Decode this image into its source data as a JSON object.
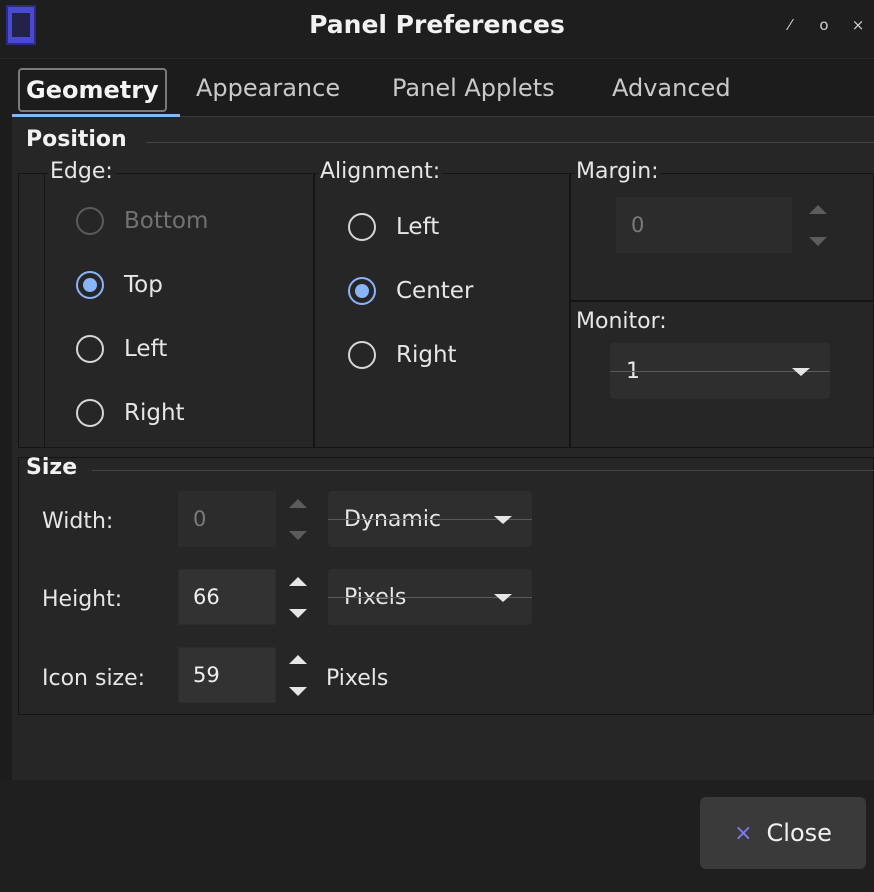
{
  "window": {
    "title": "Panel Preferences",
    "controls": [
      "⁄",
      "o",
      "×"
    ]
  },
  "tabs": [
    {
      "label": "Geometry",
      "active": true
    },
    {
      "label": "Appearance",
      "active": false
    },
    {
      "label": "Panel Applets",
      "active": false
    },
    {
      "label": "Advanced",
      "active": false
    }
  ],
  "position": {
    "title": "Position",
    "edge": {
      "label": "Edge:",
      "options": [
        {
          "label": "Bottom",
          "checked": false,
          "disabled": true
        },
        {
          "label": "Top",
          "checked": true,
          "disabled": false
        },
        {
          "label": "Left",
          "checked": false,
          "disabled": false
        },
        {
          "label": "Right",
          "checked": false,
          "disabled": false
        }
      ]
    },
    "alignment": {
      "label": "Alignment:",
      "options": [
        {
          "label": "Left",
          "checked": false
        },
        {
          "label": "Center",
          "checked": true
        },
        {
          "label": "Right",
          "checked": false
        }
      ]
    },
    "margin": {
      "label": "Margin:",
      "value": "0",
      "disabled": true
    },
    "monitor": {
      "label": "Monitor:",
      "value": "1"
    }
  },
  "size": {
    "title": "Size",
    "width": {
      "label": "Width:",
      "value": "0",
      "unit": "Dynamic",
      "disabled": true
    },
    "height": {
      "label": "Height:",
      "value": "66",
      "unit": "Pixels"
    },
    "icon_size": {
      "label": "Icon size:",
      "value": "59",
      "unit": "Pixels"
    }
  },
  "footer": {
    "close_label": "Close",
    "close_icon": "×"
  },
  "colors": {
    "accent": "#8ab4f8",
    "close_icon": "#7c7cf0"
  }
}
